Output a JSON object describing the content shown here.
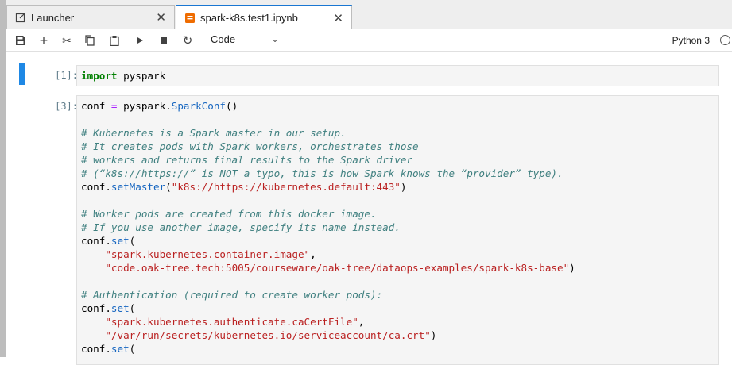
{
  "tabs": [
    {
      "label": "Launcher",
      "icon": "launcher-icon",
      "close": "✕"
    },
    {
      "label": "spark-k8s.test1.ipynb",
      "icon": "notebook-icon",
      "close": "✕"
    }
  ],
  "toolbar": {
    "cell_type": "Code",
    "kernel": "Python 3",
    "icons": [
      "save-icon",
      "add-cell-icon",
      "cut-icon",
      "copy-icon",
      "paste-icon",
      "run-icon",
      "stop-icon",
      "restart-icon"
    ]
  },
  "cells": [
    {
      "prompt": "[1]:",
      "lines": [
        [
          {
            "t": "kw",
            "v": "import"
          },
          {
            "t": "",
            "v": " pyspark"
          }
        ]
      ]
    },
    {
      "prompt": "[3]:",
      "lines": [
        [
          {
            "t": "",
            "v": "conf "
          },
          {
            "t": "op",
            "v": "="
          },
          {
            "t": "",
            "v": " pyspark."
          },
          {
            "t": "fn",
            "v": "SparkConf"
          },
          {
            "t": "",
            "v": "()"
          }
        ],
        [],
        [
          {
            "t": "cm",
            "v": "# Kubernetes is a Spark master in our setup."
          }
        ],
        [
          {
            "t": "cm",
            "v": "# It creates pods with Spark workers, orchestrates those"
          }
        ],
        [
          {
            "t": "cm",
            "v": "# workers and returns final results to the Spark driver"
          }
        ],
        [
          {
            "t": "cm",
            "v": "# (“k8s://https://” is NOT a typo, this is how Spark knows the “provider” type)."
          }
        ],
        [
          {
            "t": "",
            "v": "conf."
          },
          {
            "t": "fn",
            "v": "setMaster"
          },
          {
            "t": "",
            "v": "("
          },
          {
            "t": "str",
            "v": "\"k8s://https://kubernetes.default:443\""
          },
          {
            "t": "",
            "v": ")"
          }
        ],
        [],
        [
          {
            "t": "cm",
            "v": "# Worker pods are created from this docker image."
          }
        ],
        [
          {
            "t": "cm",
            "v": "# If you use another image, specify its name instead."
          }
        ],
        [
          {
            "t": "",
            "v": "conf."
          },
          {
            "t": "fn",
            "v": "set"
          },
          {
            "t": "",
            "v": "("
          }
        ],
        [
          {
            "t": "",
            "v": "    "
          },
          {
            "t": "str",
            "v": "\"spark.kubernetes.container.image\""
          },
          {
            "t": "",
            "v": ","
          }
        ],
        [
          {
            "t": "",
            "v": "    "
          },
          {
            "t": "str",
            "v": "\"code.oak-tree.tech:5005/courseware/oak-tree/dataops-examples/spark-k8s-base\""
          },
          {
            "t": "",
            "v": ")"
          }
        ],
        [],
        [
          {
            "t": "cm",
            "v": "# Authentication (required to create worker pods):"
          }
        ],
        [
          {
            "t": "",
            "v": "conf."
          },
          {
            "t": "fn",
            "v": "set"
          },
          {
            "t": "",
            "v": "("
          }
        ],
        [
          {
            "t": "",
            "v": "    "
          },
          {
            "t": "str",
            "v": "\"spark.kubernetes.authenticate.caCertFile\""
          },
          {
            "t": "",
            "v": ","
          }
        ],
        [
          {
            "t": "",
            "v": "    "
          },
          {
            "t": "str",
            "v": "\"/var/run/secrets/kubernetes.io/serviceaccount/ca.crt\""
          },
          {
            "t": "",
            "v": ")"
          }
        ],
        [
          {
            "t": "",
            "v": "conf."
          },
          {
            "t": "fn",
            "v": "set"
          },
          {
            "t": "",
            "v": "("
          }
        ]
      ]
    }
  ]
}
